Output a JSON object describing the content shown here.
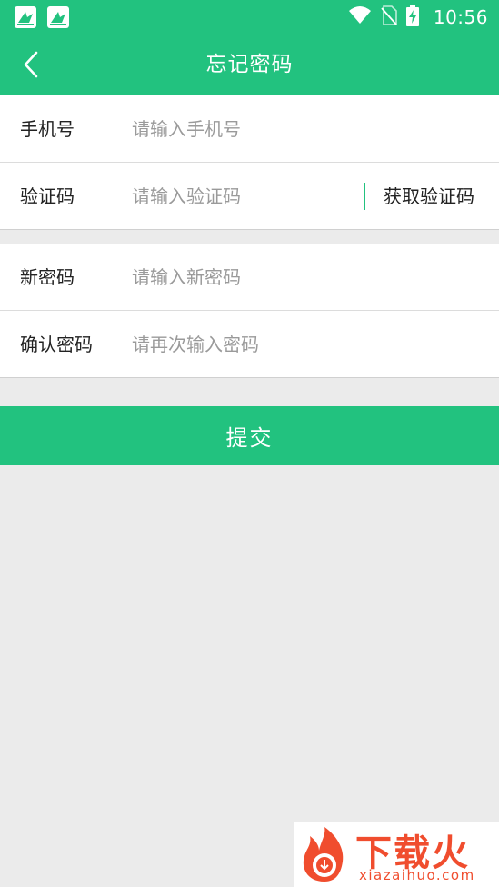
{
  "status_bar": {
    "time": "10:56",
    "icons": [
      "app-notification-icon",
      "app-notification-icon",
      "wifi-icon",
      "no-sim-icon",
      "battery-charging-icon"
    ]
  },
  "header": {
    "title": "忘记密码",
    "back_icon": "chevron-left-icon"
  },
  "form": {
    "phone": {
      "label": "手机号",
      "placeholder": "请输入手机号",
      "value": ""
    },
    "code": {
      "label": "验证码",
      "placeholder": "请输入验证码",
      "value": "",
      "get_code_label": "获取验证码"
    },
    "new_password": {
      "label": "新密码",
      "placeholder": "请输入新密码",
      "value": ""
    },
    "confirm_password": {
      "label": "确认密码",
      "placeholder": "请再次输入密码",
      "value": ""
    }
  },
  "submit_label": "提交",
  "watermark": {
    "text": "下载火",
    "url": "xiazaihuo.com"
  },
  "colors": {
    "primary": "#22c27f",
    "background": "#ebebeb",
    "watermark": "#f04d2e"
  }
}
